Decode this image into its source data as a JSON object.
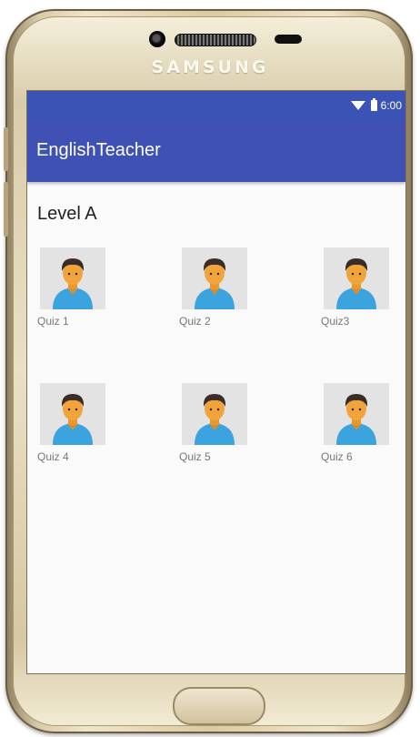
{
  "device": {
    "brand": "SAMSUNG"
  },
  "status_bar": {
    "time": "6:00",
    "wifi_icon": "wifi-icon",
    "battery_icon": "battery-icon"
  },
  "app_bar": {
    "title": "EnglishTeacher",
    "color": "#3f51b5"
  },
  "content": {
    "level_title": "Level A",
    "quizzes": [
      {
        "label": "Quiz 1",
        "icon": "person-avatar-icon"
      },
      {
        "label": "Quiz 2",
        "icon": "person-avatar-icon"
      },
      {
        "label": "Quiz3",
        "icon": "person-avatar-icon"
      },
      {
        "label": "Quiz 4",
        "icon": "person-avatar-icon"
      },
      {
        "label": "Quiz 5",
        "icon": "person-avatar-icon"
      },
      {
        "label": "Quiz 6",
        "icon": "person-avatar-icon"
      }
    ]
  },
  "colors": {
    "status_bar": "#3a53b4",
    "app_bar": "#3f51b5",
    "avatar_shirt": "#3ba4df",
    "avatar_skin": "#f0a43a"
  }
}
